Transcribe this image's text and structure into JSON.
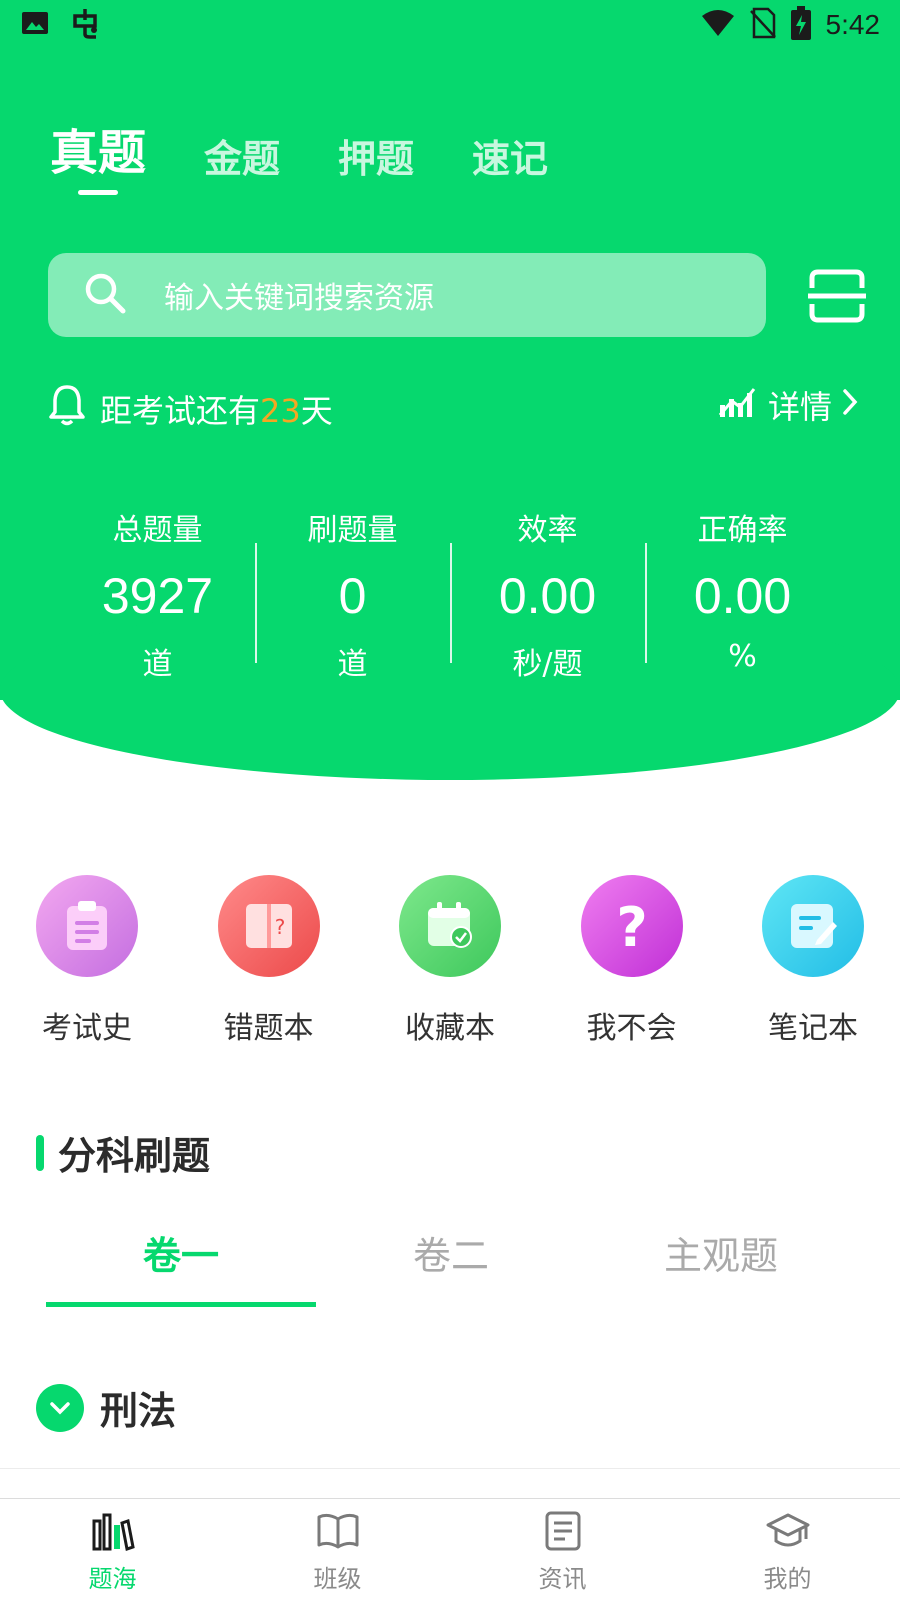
{
  "status_bar": {
    "time": "5:42",
    "left_icons": [
      "image-icon",
      "bug-app-icon"
    ],
    "right_icons": [
      "wifi-icon",
      "no-sim-icon",
      "battery-charging-icon"
    ]
  },
  "top_tabs": [
    {
      "label": "真题",
      "active": true
    },
    {
      "label": "金题",
      "active": false
    },
    {
      "label": "押题",
      "active": false
    },
    {
      "label": "速记",
      "active": false
    }
  ],
  "search": {
    "placeholder": "输入关键词搜索资源"
  },
  "countdown": {
    "prefix": "距考试还有",
    "days": "23",
    "suffix": "天"
  },
  "details_link": {
    "label": "详情"
  },
  "stats": [
    {
      "label": "总题量",
      "value": "3927",
      "unit": "道"
    },
    {
      "label": "刷题量",
      "value": "0",
      "unit": "道"
    },
    {
      "label": "效率",
      "value": "0.00",
      "unit": "秒/题"
    },
    {
      "label": "正确率",
      "value": "0.00",
      "unit": "%"
    }
  ],
  "shortcuts": [
    {
      "label": "考试史",
      "icon": "clipboard-icon"
    },
    {
      "label": "错题本",
      "icon": "wrong-book-icon"
    },
    {
      "label": "收藏本",
      "icon": "calendar-check-icon"
    },
    {
      "label": "我不会",
      "icon": "question-icon"
    },
    {
      "label": "笔记本",
      "icon": "note-edit-icon"
    }
  ],
  "section": {
    "title": "分科刷题"
  },
  "paper_tabs": [
    {
      "label": "卷一",
      "active": true
    },
    {
      "label": "卷二",
      "active": false
    },
    {
      "label": "主观题",
      "active": false
    }
  ],
  "subject": {
    "label": "刑法"
  },
  "bottom_nav": [
    {
      "label": "题海",
      "icon": "books-icon",
      "active": true
    },
    {
      "label": "班级",
      "icon": "open-book-icon",
      "active": false
    },
    {
      "label": "资讯",
      "icon": "news-icon",
      "active": false
    },
    {
      "label": "我的",
      "icon": "graduation-cap-icon",
      "active": false
    }
  ],
  "colors": {
    "brand_green": "#06d86e",
    "accent_orange": "#f5a623",
    "inactive_text": "#aaaaaa"
  }
}
